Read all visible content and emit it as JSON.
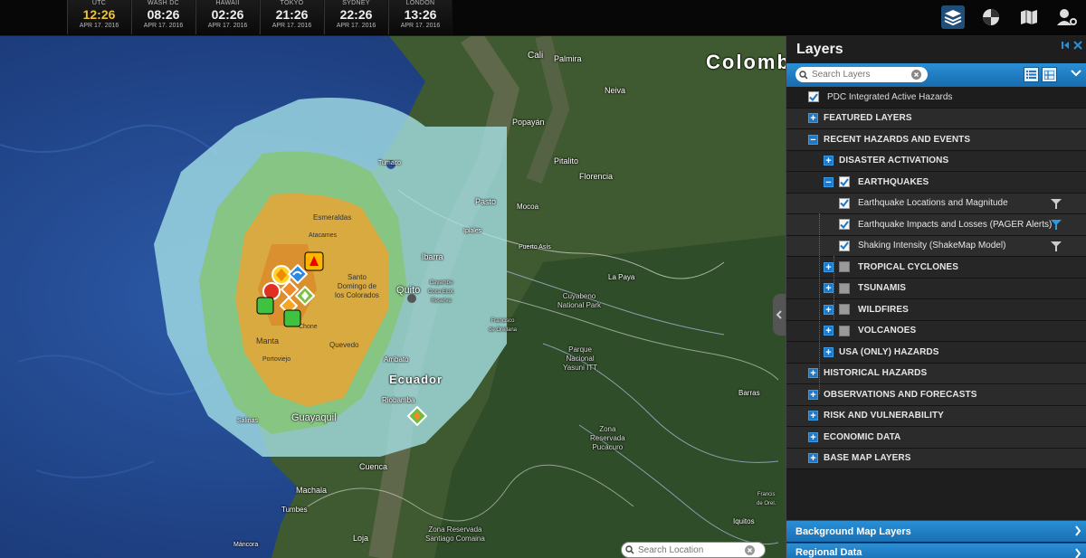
{
  "clocks": [
    {
      "city": "UTC",
      "time": "12:26",
      "date": "APR 17. 2016"
    },
    {
      "city": "WASH DC",
      "time": "08:26",
      "date": "APR 17. 2016"
    },
    {
      "city": "HAWAII",
      "time": "02:26",
      "date": "APR 17. 2016"
    },
    {
      "city": "TOKYO",
      "time": "21:26",
      "date": "APR 17. 2016"
    },
    {
      "city": "SYDNEY",
      "time": "22:26",
      "date": "APR 17. 2016"
    },
    {
      "city": "LONDON",
      "time": "13:26",
      "date": "APR 17. 2016"
    }
  ],
  "top_icons": [
    "layers-icon",
    "globe-icon",
    "map-book-icon",
    "user-settings-icon"
  ],
  "map": {
    "labels": {
      "cali": "Cali",
      "palmira": "Palmira",
      "colombia": "Colomb",
      "neiva": "Neiva",
      "popayan": "Popayán",
      "pitalito": "Pitalito",
      "florencia": "Florencia",
      "tumaco": "Tumaco",
      "pasto": "Pasto",
      "mocoa": "Mocoa",
      "esmeraldas": "Esmeraldas",
      "atacames": "Atacames",
      "ipiales": "Ipiales",
      "puerto_asis": "Puerto Asís",
      "ibarra": "Ibarra",
      "la_paya": "La Paya",
      "santo_domingo": "Santo\nDomingo de\nlos Colorados",
      "quito": "Quito",
      "cayambe": "Cayambe\nCoca Ecol.\nReserve",
      "cuyabeno": "Cuyabeno\nNational Park",
      "francisco": "Francisco\nde Orellana",
      "chone": "Chone",
      "manta": "Manta",
      "quevedo": "Quevedo",
      "portoviejo": "Portoviejo",
      "parque_yasuni": "Parque\nNacional\nYasuni ITT",
      "ambato": "Ambato",
      "ecuador": "Ecuador",
      "riobamba": "Riobamba",
      "barras": "Barras",
      "guayaquil": "Guayaquil",
      "salinas": "Salinas",
      "zona_pucacuro": "Zona\nReservada\nPucacuro",
      "cuenca": "Cuenca",
      "machala": "Machala",
      "tumbes": "Tumbes",
      "iquitos": "Iquitos",
      "zona_santiago": "Zona Reservada\nSantiago Comaina",
      "loja": "Loja",
      "mancora": "Máncora",
      "francisco_orellana2": "Francis\nde Orel."
    },
    "search_location": {
      "placeholder": "Search Location"
    }
  },
  "panel": {
    "title": "Layers",
    "search": {
      "placeholder": "Search Layers"
    },
    "tree": {
      "pdc": "PDC Integrated Active Hazards",
      "featured": "FEATURED LAYERS",
      "recent": "RECENT HAZARDS AND EVENTS",
      "disaster": "DISASTER ACTIVATIONS",
      "earthquakes": "EARTHQUAKES",
      "eq_locations": "Earthquake Locations and Magnitude",
      "eq_impacts": "Earthquake Impacts and Losses (PAGER Alerts)",
      "eq_shaking": "Shaking Intensity (ShakeMap Model)",
      "cyclones": "TROPICAL CYCLONES",
      "tsunamis": "TSUNAMIS",
      "wildfires": "WILDFIRES",
      "volcanoes": "VOLCANOES",
      "usa": "USA (ONLY) HAZARDS",
      "historical": "HISTORICAL HAZARDS",
      "observations": "OBSERVATIONS AND FORECASTS",
      "risk": "RISK AND VULNERABILITY",
      "economic": "ECONOMIC DATA",
      "basemap": "BASE MAP LAYERS"
    },
    "sections": {
      "background": "Background Map Layers",
      "regional": "Regional Data"
    }
  },
  "colors": {
    "accent_blue": "#1e78c8",
    "utc_time": "#f1c232",
    "ocean": "#1d3a78",
    "shake_light": "#9ddbe2",
    "shake_green": "#8cc878",
    "shake_orange": "#e6a032"
  }
}
